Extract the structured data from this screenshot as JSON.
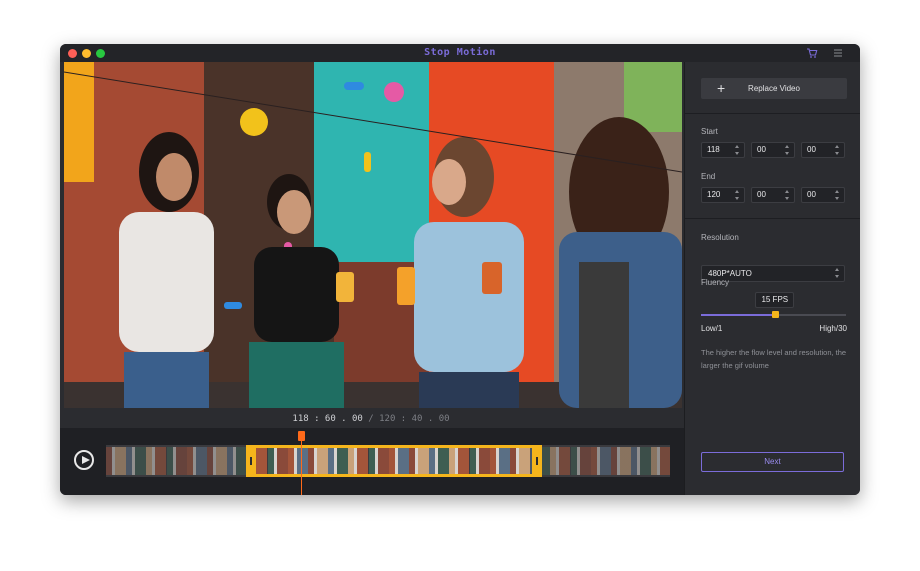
{
  "window": {
    "title": "Stop Motion"
  },
  "toolbar": {
    "cart_icon": "cart-icon",
    "menu_icon": "hamburger-menu-icon"
  },
  "player": {
    "time_current": "118 : 60 . 00",
    "time_separator": " / ",
    "time_total": "120 : 40 . 00"
  },
  "sidebar": {
    "replace_label": "Replace Video",
    "start_label": "Start",
    "start": [
      "118",
      "00",
      "00"
    ],
    "end_label": "End",
    "end": [
      "120",
      "00",
      "00"
    ],
    "resolution_label": "Resolution",
    "resolution_value": "480P*AUTO",
    "fluency_label": "Fluency",
    "fps_value": "15 FPS",
    "fluency_level": 0.51,
    "low_label": "Low/1",
    "high_label": "High/30",
    "note": "The higher the flow level and resolution, the larger the gif volume",
    "next_label": "Next"
  },
  "colors": {
    "accent": "#7b6cd9",
    "selection": "#f5b51c",
    "playhead": "#ff6a1a"
  }
}
